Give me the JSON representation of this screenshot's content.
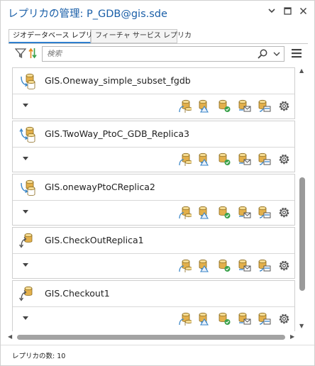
{
  "window": {
    "title": "レプリカの管理: P_GDB@gis.sde",
    "controls": [
      "chevron-down-icon",
      "maximize-icon",
      "close-icon"
    ]
  },
  "tabs": [
    {
      "label": "ジオデータベース レプリカ",
      "active": true
    },
    {
      "label": "フィーチャ サービス レプリカ",
      "active": false
    }
  ],
  "toolbar": {
    "search_placeholder": "検索",
    "icons": [
      "filter-icon",
      "sort-icon",
      "search-icon",
      "chevron-down-icon",
      "menu-icon"
    ]
  },
  "replicas": [
    {
      "name": "GIS.Oneway_simple_subset_fgdb",
      "icon": "one-way-replica-icon"
    },
    {
      "name": "GIS.TwoWay_PtoC_GDB_Replica3",
      "icon": "two-way-replica-icon"
    },
    {
      "name": "GIS.onewayPtoCReplica2",
      "icon": "one-way-replica-icon"
    },
    {
      "name": "GIS.CheckOutReplica1",
      "icon": "checkout-replica-icon"
    },
    {
      "name": "GIS.Checkout1",
      "icon": "checkout-replica-icon"
    }
  ],
  "actions": [
    "synchronize-icon",
    "export-changes-icon",
    "import-changes-icon",
    "re-export-messages-icon",
    "unregister-replica-icon",
    "settings-icon"
  ],
  "colors": {
    "title": "#1a5fa8",
    "tab_accent": "#2f7fce",
    "db_gold": "#e3b04b",
    "db_blue": "#3a86c8",
    "check_green": "#3aa14a"
  },
  "status": {
    "text": "レプリカの数: 10"
  }
}
